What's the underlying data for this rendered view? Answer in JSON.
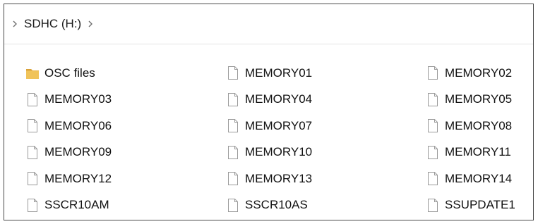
{
  "address_bar": {
    "location": "SDHC (H:)",
    "left_chevron_icon": "chevron-right-icon",
    "right_chevron_icon": "chevron-right-icon"
  },
  "files": [
    {
      "name": "OSC files",
      "type": "folder",
      "icon": "folder-icon"
    },
    {
      "name": "MEMORY01",
      "type": "file",
      "icon": "file-icon"
    },
    {
      "name": "MEMORY02",
      "type": "file",
      "icon": "file-icon"
    },
    {
      "name": "MEMORY03",
      "type": "file",
      "icon": "file-icon"
    },
    {
      "name": "MEMORY04",
      "type": "file",
      "icon": "file-icon"
    },
    {
      "name": "MEMORY05",
      "type": "file",
      "icon": "file-icon"
    },
    {
      "name": "MEMORY06",
      "type": "file",
      "icon": "file-icon"
    },
    {
      "name": "MEMORY07",
      "type": "file",
      "icon": "file-icon"
    },
    {
      "name": "MEMORY08",
      "type": "file",
      "icon": "file-icon"
    },
    {
      "name": "MEMORY09",
      "type": "file",
      "icon": "file-icon"
    },
    {
      "name": "MEMORY10",
      "type": "file",
      "icon": "file-icon"
    },
    {
      "name": "MEMORY11",
      "type": "file",
      "icon": "file-icon"
    },
    {
      "name": "MEMORY12",
      "type": "file",
      "icon": "file-icon"
    },
    {
      "name": "MEMORY13",
      "type": "file",
      "icon": "file-icon"
    },
    {
      "name": "MEMORY14",
      "type": "file",
      "icon": "file-icon"
    },
    {
      "name": "SSCR10AM",
      "type": "file",
      "icon": "file-icon"
    },
    {
      "name": "SSCR10AS",
      "type": "file",
      "icon": "file-icon"
    },
    {
      "name": "SSUPDATE1",
      "type": "file",
      "icon": "file-icon"
    }
  ],
  "colors": {
    "folder": "#e8b64c",
    "folder_dark": "#d9a23a",
    "file_border": "#9a9a9a",
    "chevron": "#707070"
  }
}
